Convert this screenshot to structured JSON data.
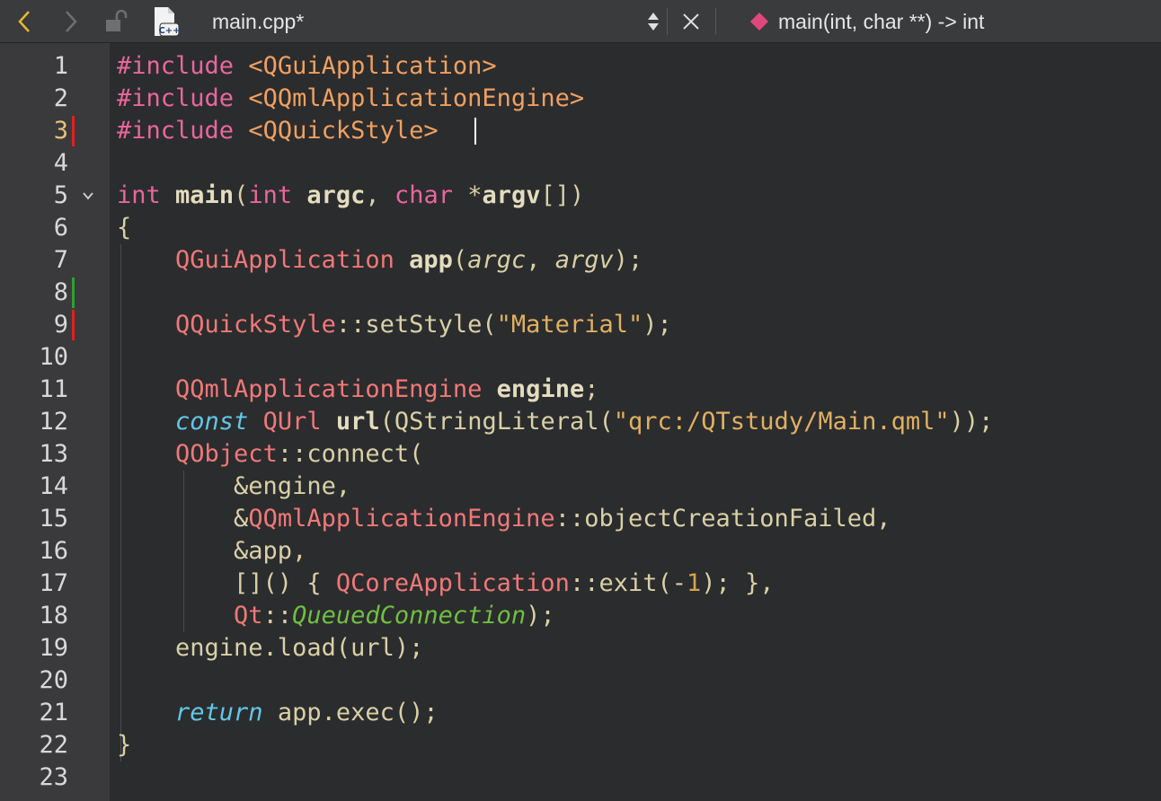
{
  "toolbar": {
    "filename": "main.cpp*",
    "symbol": "main(int, char **) -> int",
    "file_type_badge": "C++",
    "icons": [
      "back-arrow-icon",
      "forward-arrow-icon",
      "unlock-icon",
      "cpp-file-icon",
      "up-down-icon",
      "close-icon",
      "function-symbol-icon"
    ]
  },
  "editor": {
    "current_line": 3,
    "gutter_markers": {
      "changed": [
        3,
        9
      ],
      "added": [
        8
      ]
    },
    "fold_line": 5,
    "lines": [
      {
        "n": "1",
        "t": "#include <QGuiApplication>"
      },
      {
        "n": "2",
        "t": "#include <QQmlApplicationEngine>"
      },
      {
        "n": "3",
        "t": "#include <QQuickStyle>"
      },
      {
        "n": "4",
        "t": ""
      },
      {
        "n": "5",
        "t": "int main(int argc, char *argv[])"
      },
      {
        "n": "6",
        "t": "{"
      },
      {
        "n": "7",
        "t": "    QGuiApplication app(argc, argv);"
      },
      {
        "n": "8",
        "t": ""
      },
      {
        "n": "9",
        "t": "    QQuickStyle::setStyle(\"Material\");"
      },
      {
        "n": "10",
        "t": ""
      },
      {
        "n": "11",
        "t": "    QQmlApplicationEngine engine;"
      },
      {
        "n": "12",
        "t": "    const QUrl url(QStringLiteral(\"qrc:/QTstudy/Main.qml\"));"
      },
      {
        "n": "13",
        "t": "    QObject::connect("
      },
      {
        "n": "14",
        "t": "        &engine,"
      },
      {
        "n": "15",
        "t": "        &QQmlApplicationEngine::objectCreationFailed,"
      },
      {
        "n": "16",
        "t": "        &app,"
      },
      {
        "n": "17",
        "t": "        []() { QCoreApplication::exit(-1); },"
      },
      {
        "n": "18",
        "t": "        Qt::QueuedConnection);"
      },
      {
        "n": "19",
        "t": "    engine.load(url);"
      },
      {
        "n": "20",
        "t": ""
      },
      {
        "n": "21",
        "t": "    return app.exec();"
      },
      {
        "n": "22",
        "t": "}"
      },
      {
        "n": "23",
        "t": ""
      }
    ]
  },
  "colors": {
    "background": "#2b2c2e",
    "gutter": "#3a3a3c",
    "marker_changed": "#e02020",
    "marker_added": "#2fa02f",
    "current_line_number": "#e5c07b"
  }
}
